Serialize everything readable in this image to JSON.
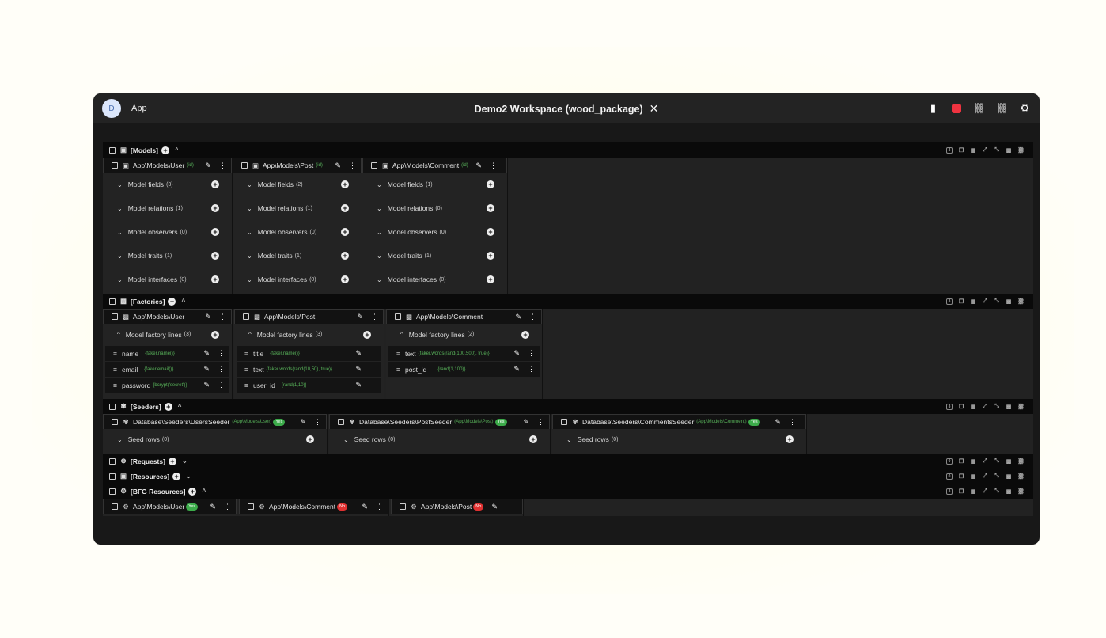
{
  "titlebar": {
    "avatar_letter": "D",
    "app_name": "App",
    "title": "Demo2 Workspace (wood_package)",
    "close_symbol": "✕",
    "icons": [
      "scroll-icon",
      "stop-icon",
      "database-arrow-icon",
      "database-arrow-back-icon",
      "gear-icon"
    ],
    "stop_color": "#ef3340"
  },
  "models": {
    "label": "[Models]",
    "cards": [
      {
        "name": "App\\Models\\User",
        "suffix": "(id)",
        "rows": [
          {
            "label": "Model fields",
            "count": "(3)"
          },
          {
            "label": "Model relations",
            "count": "(1)"
          },
          {
            "label": "Model observers",
            "count": "(0)"
          },
          {
            "label": "Model traits",
            "count": "(1)"
          },
          {
            "label": "Model interfaces",
            "count": "(0)"
          }
        ]
      },
      {
        "name": "App\\Models\\Post",
        "suffix": "(id)",
        "rows": [
          {
            "label": "Model fields",
            "count": "(2)"
          },
          {
            "label": "Model relations",
            "count": "(1)"
          },
          {
            "label": "Model observers",
            "count": "(0)"
          },
          {
            "label": "Model traits",
            "count": "(1)"
          },
          {
            "label": "Model interfaces",
            "count": "(0)"
          }
        ]
      },
      {
        "name": "App\\Models\\Comment",
        "suffix": "(id)",
        "rows": [
          {
            "label": "Model fields",
            "count": "(1)"
          },
          {
            "label": "Model relations",
            "count": "(0)"
          },
          {
            "label": "Model observers",
            "count": "(0)"
          },
          {
            "label": "Model traits",
            "count": "(1)"
          },
          {
            "label": "Model interfaces",
            "count": "(0)"
          }
        ]
      }
    ]
  },
  "factories": {
    "label": "[Factories]",
    "cards": [
      {
        "name": "App\\Models\\User",
        "lines_label": "Model factory lines",
        "lines_count": "(3)",
        "lines": [
          {
            "field": "name",
            "faker": "{faker.name()}"
          },
          {
            "field": "email",
            "faker": "{faker.email()}"
          },
          {
            "field": "password",
            "faker": "{bcrypt('secret')}"
          }
        ]
      },
      {
        "name": "App\\Models\\Post",
        "lines_label": "Model factory lines",
        "lines_count": "(3)",
        "lines": [
          {
            "field": "title",
            "faker": "{faker.name()}"
          },
          {
            "field": "text",
            "faker": "{faker.words(rand(10,50), true)}"
          },
          {
            "field": "user_id",
            "faker": "{rand(1,10)}"
          }
        ]
      },
      {
        "name": "App\\Models\\Comment",
        "lines_label": "Model factory lines",
        "lines_count": "(2)",
        "lines": [
          {
            "field": "text",
            "faker": "{faker.words(rand(100,500), true)}"
          },
          {
            "field": "post_id",
            "faker": "{rand(1,100)}"
          }
        ]
      }
    ]
  },
  "seeders": {
    "label": "[Seeders]",
    "cards": [
      {
        "name": "Database\\Seeders\\UsersSeeder",
        "model": "(App\\Models\\User)",
        "badge": "Yes",
        "rows_label": "Seed rows",
        "rows_count": "(0)"
      },
      {
        "name": "Database\\Seeders\\PostSeeder",
        "model": "(App\\Models\\Post)",
        "badge": "Yes",
        "rows_label": "Seed rows",
        "rows_count": "(0)"
      },
      {
        "name": "Database\\Seeders\\CommentsSeeder",
        "model": "(App\\Models\\Comment)",
        "badge": "Yes",
        "rows_label": "Seed rows",
        "rows_count": "(0)"
      }
    ]
  },
  "requests": {
    "label": "[Requests]"
  },
  "resources": {
    "label": "[Resources]"
  },
  "bfg_resources": {
    "label": "[BFG Resources]",
    "cards": [
      {
        "name": "App\\Models\\User",
        "badge": "Yes",
        "badge_color": "#3cab4a"
      },
      {
        "name": "App\\Models\\Comment",
        "badge": "No",
        "badge_color": "#e03131"
      },
      {
        "name": "App\\Models\\Post",
        "badge": "No",
        "badge_color": "#e03131"
      }
    ]
  }
}
